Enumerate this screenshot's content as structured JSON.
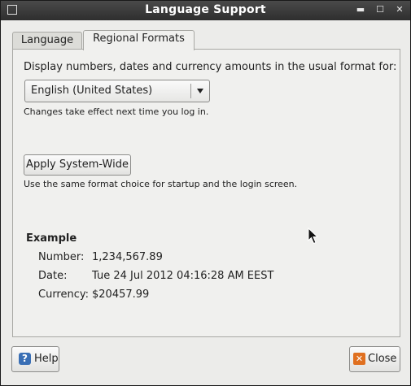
{
  "window": {
    "title": "Language Support"
  },
  "tabs": [
    {
      "label": "Language"
    },
    {
      "label": "Regional Formats"
    }
  ],
  "regional": {
    "prompt": "Display numbers, dates and currency amounts in the usual format for:",
    "format_select": {
      "value": "English (United States)"
    },
    "login_note": "Changes take effect next time you log in.",
    "apply_button": "Apply System-Wide",
    "apply_note": "Use the same format choice for startup and the login screen."
  },
  "example": {
    "heading": "Example",
    "rows": [
      {
        "label": "Number:",
        "value": "1,234,567.89"
      },
      {
        "label": "Date:",
        "value": "Tue 24 Jul 2012 04:16:28 AM EEST"
      },
      {
        "label": "Currency:",
        "value": "$20457.99"
      }
    ]
  },
  "footer": {
    "help_label": "Help",
    "close_label": "Close"
  },
  "icons": {
    "help": "help-icon",
    "close": "close-icon",
    "dropdown": "chevron-down-icon"
  },
  "colors": {
    "titlebar": "#353535",
    "window_bg": "#ececea",
    "help_icon": "#3a6fb5",
    "close_icon": "#e07020"
  }
}
